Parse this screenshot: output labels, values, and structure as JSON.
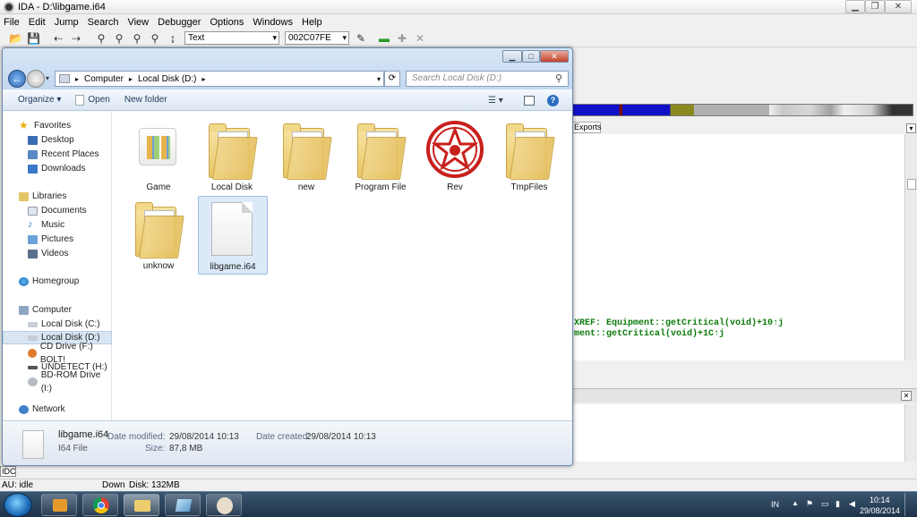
{
  "ida": {
    "title": "IDA - D:\\libgame.i64",
    "menu": [
      "File",
      "Edit",
      "Jump",
      "Search",
      "View",
      "Debugger",
      "Options",
      "Windows",
      "Help"
    ],
    "toolbar": {
      "mode_select": "Text",
      "address_select": "002C07FE"
    },
    "exports_tab": "Exports",
    "code_lines": [
      "XREF: Equipment::getCritical(void)+10↑j",
      "ment::getCritical(void)+1C↑j"
    ],
    "idc_label": "IDC",
    "status": {
      "au": "AU:  idle",
      "direction": "Down",
      "disk": "Disk: 132MB"
    }
  },
  "explorer": {
    "breadcrumb": [
      "Computer",
      "Local Disk (D:)"
    ],
    "search_placeholder": "Search Local Disk (D:)",
    "commands": {
      "organize": "Organize ▾",
      "open": "Open",
      "new_folder": "New folder"
    },
    "nav": [
      {
        "label": "Favorites",
        "icon": "star-icon",
        "level": 0
      },
      {
        "label": "Desktop",
        "icon": "desktop-icon",
        "level": 1
      },
      {
        "label": "Recent Places",
        "icon": "recent-places-icon",
        "level": 1
      },
      {
        "label": "Downloads",
        "icon": "downloads-icon",
        "level": 1
      },
      {
        "label": "Libraries",
        "icon": "libraries-icon",
        "level": 0
      },
      {
        "label": "Documents",
        "icon": "documents-icon",
        "level": 1
      },
      {
        "label": "Music",
        "icon": "music-icon",
        "level": 1
      },
      {
        "label": "Pictures",
        "icon": "pictures-icon",
        "level": 1
      },
      {
        "label": "Videos",
        "icon": "videos-icon",
        "level": 1
      },
      {
        "label": "Homegroup",
        "icon": "homegroup-icon",
        "level": 0
      },
      {
        "label": "Computer",
        "icon": "computer-icon",
        "level": 0
      },
      {
        "label": "Local Disk (C:)",
        "icon": "drive-icon",
        "level": 1
      },
      {
        "label": "Local Disk (D:)",
        "icon": "drive-icon",
        "level": 1,
        "selected": true
      },
      {
        "label": "CD Drive (F:) BOLT!",
        "icon": "cd-drive-icon",
        "level": 1
      },
      {
        "label": "UNDETECT (H:)",
        "icon": "usb-drive-icon",
        "level": 1
      },
      {
        "label": "BD-ROM Drive (I:)",
        "icon": "bd-rom-icon",
        "level": 1
      },
      {
        "label": "Network",
        "icon": "network-icon",
        "level": 0
      }
    ],
    "files": [
      {
        "name": "Game",
        "type": "app-folder"
      },
      {
        "name": "Local Disk",
        "type": "folder"
      },
      {
        "name": "new",
        "type": "folder"
      },
      {
        "name": "Program File",
        "type": "folder"
      },
      {
        "name": "Rev",
        "type": "rev-folder"
      },
      {
        "name": "TmpFiles",
        "type": "folder"
      },
      {
        "name": "unknow",
        "type": "folder"
      },
      {
        "name": "libgame.i64",
        "type": "file",
        "selected": true
      }
    ],
    "details": {
      "filename": "libgame.i64",
      "filetype": "I64 File",
      "modified_label": "Date modified:",
      "modified_value": "29/08/2014 10:13",
      "size_label": "Size:",
      "size_value": "87,8 MB",
      "created_label": "Date created:",
      "created_value": "29/08/2014 10:13"
    }
  },
  "taskbar": {
    "lang": "IN",
    "time": "10:14",
    "date": "29/08/2014"
  }
}
